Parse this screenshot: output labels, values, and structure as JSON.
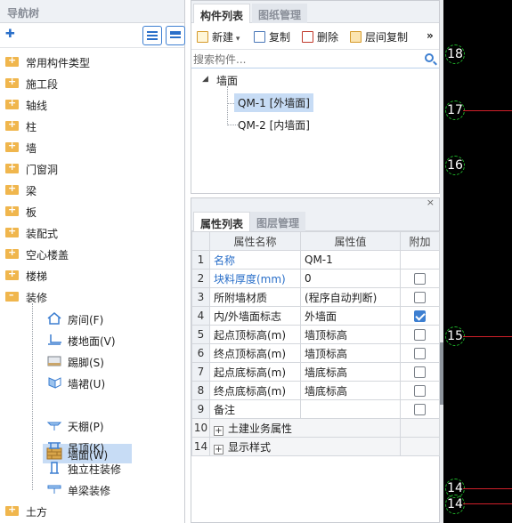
{
  "nav": {
    "title": "导航树",
    "items": [
      {
        "label": "常用构件类型"
      },
      {
        "label": "施工段"
      },
      {
        "label": "轴线"
      },
      {
        "label": "柱"
      },
      {
        "label": "墙"
      },
      {
        "label": "门窗洞"
      },
      {
        "label": "梁"
      },
      {
        "label": "板"
      },
      {
        "label": "装配式"
      },
      {
        "label": "空心楼盖"
      },
      {
        "label": "楼梯"
      },
      {
        "label": "装修"
      }
    ],
    "decoration_children": [
      {
        "label": "房间(F)",
        "icon": "room-icon"
      },
      {
        "label": "楼地面(V)",
        "icon": "floor-icon"
      },
      {
        "label": "踢脚(S)",
        "icon": "skirting-icon"
      },
      {
        "label": "墙裙(U)",
        "icon": "dado-icon"
      },
      {
        "label": "墙面(W)",
        "icon": "wall-surface-icon",
        "selected": true
      },
      {
        "label": "天棚(P)",
        "icon": "ceiling-icon"
      },
      {
        "label": "吊顶(K)",
        "icon": "suspended-ceiling-icon"
      },
      {
        "label": "独立柱装修",
        "icon": "column-finish-icon"
      },
      {
        "label": "单梁装修",
        "icon": "beam-finish-icon"
      }
    ],
    "last_item": "土方"
  },
  "components": {
    "tabs": [
      "构件列表",
      "图纸管理"
    ],
    "toolbar": {
      "new": "新建",
      "copy": "复制",
      "delete": "删除",
      "floor_copy": "层间复制",
      "more": "»"
    },
    "search_placeholder": "搜索构件...",
    "root": "墙面",
    "items": [
      {
        "label": "QM-1 [外墙面]",
        "selected": true
      },
      {
        "label": "QM-2 [内墙面]",
        "selected": false
      }
    ]
  },
  "properties": {
    "close": "×",
    "tabs": [
      "属性列表",
      "图层管理"
    ],
    "headers": [
      "属性名称",
      "属性值",
      "附加"
    ],
    "rows": [
      {
        "num": "1",
        "name": "名称",
        "value": "QM-1",
        "blue": true,
        "check": null
      },
      {
        "num": "2",
        "name": "块料厚度(mm)",
        "value": "0",
        "blue": true,
        "check": false
      },
      {
        "num": "3",
        "name": "所附墙材质",
        "value": "(程序自动判断)",
        "blue": false,
        "check": false
      },
      {
        "num": "4",
        "name": "内/外墙面标志",
        "value": "外墙面",
        "blue": false,
        "check": true
      },
      {
        "num": "5",
        "name": "起点顶标高(m)",
        "value": "墙顶标高",
        "blue": false,
        "check": false
      },
      {
        "num": "6",
        "name": "终点顶标高(m)",
        "value": "墙顶标高",
        "blue": false,
        "check": false
      },
      {
        "num": "7",
        "name": "起点底标高(m)",
        "value": "墙底标高",
        "blue": false,
        "check": false
      },
      {
        "num": "8",
        "name": "终点底标高(m)",
        "value": "墙底标高",
        "blue": false,
        "check": false
      },
      {
        "num": "9",
        "name": "备注",
        "value": "",
        "blue": false,
        "check": false
      }
    ],
    "groups": [
      {
        "num": "10",
        "name": "土建业务属性"
      },
      {
        "num": "14",
        "name": "显示样式"
      }
    ]
  },
  "cad": {
    "axis_labels": [
      "18",
      "17",
      "16",
      "15",
      "14",
      "14"
    ],
    "line_color": "#d0202a",
    "axis_color": "#1fb32a"
  }
}
